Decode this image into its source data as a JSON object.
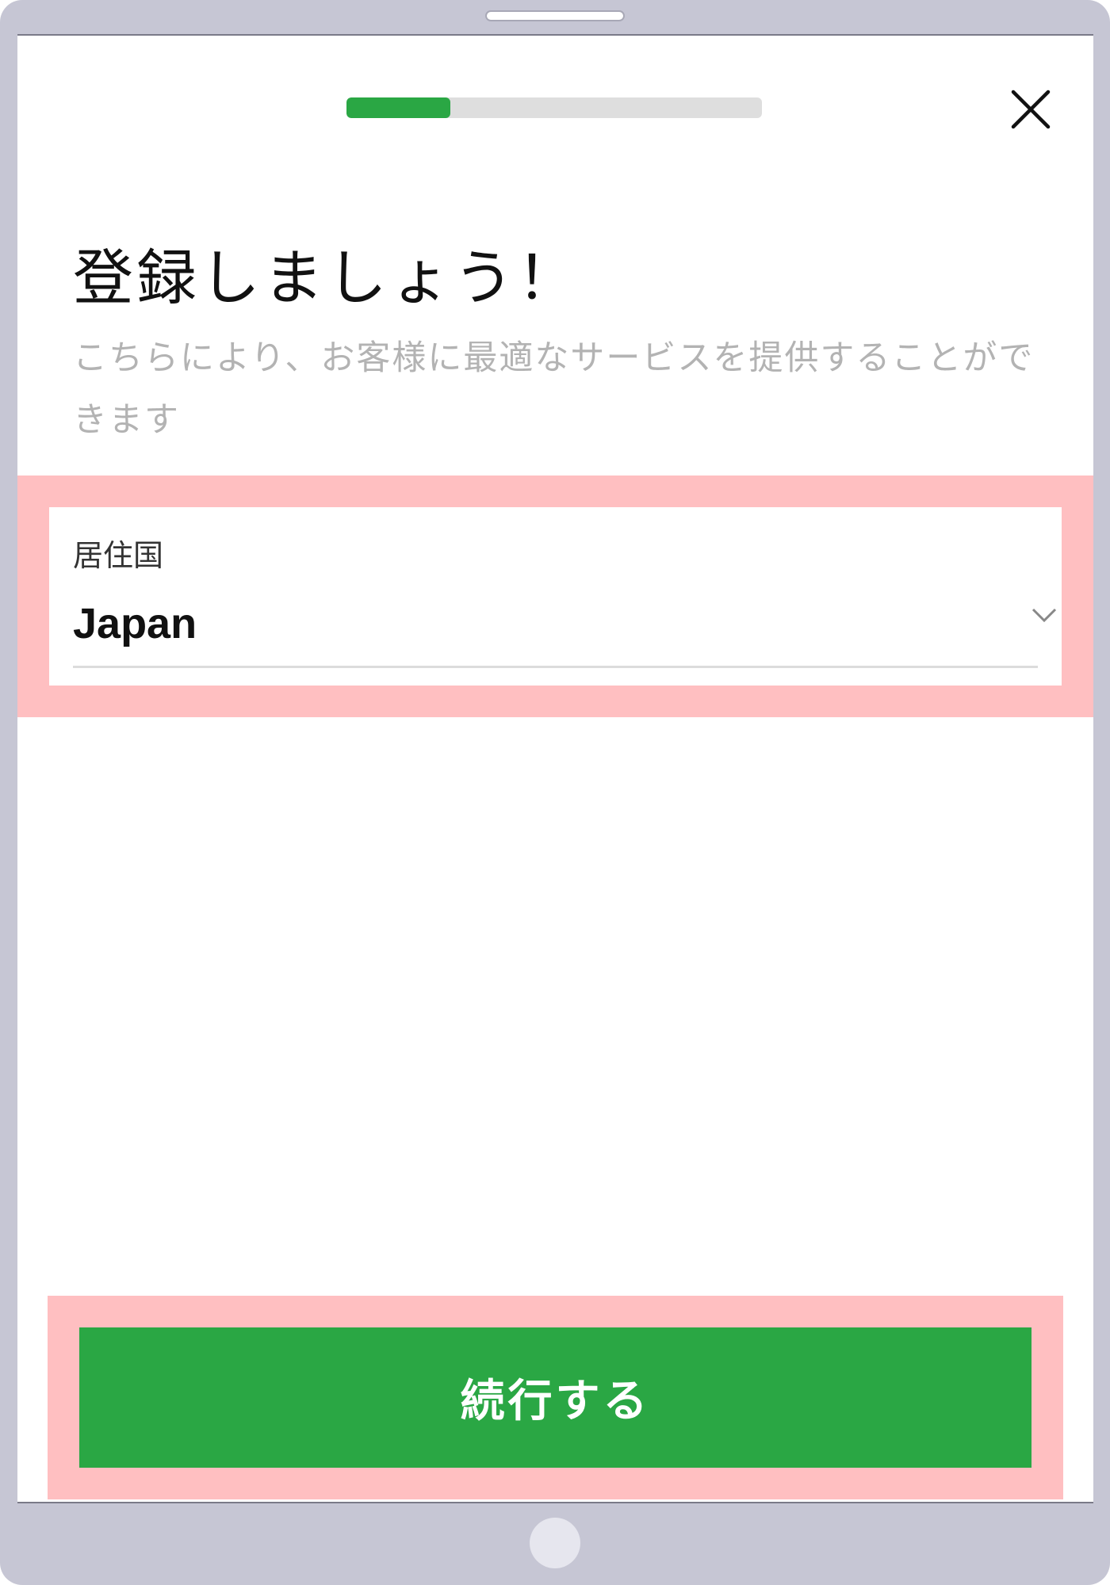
{
  "progress": {
    "fraction": 0.25
  },
  "header": {
    "close_icon": "close-icon"
  },
  "main": {
    "title": "登録しましょう！",
    "subtitle": "こちらにより、お客様に最適なサービスを提供することができます"
  },
  "country_field": {
    "label": "居住国",
    "value": "Japan",
    "icon": "chevron-down-icon"
  },
  "footer": {
    "continue_label": "続行する"
  },
  "colors": {
    "accent": "#2aa744",
    "highlight": "#ffbfc1",
    "progress_track": "#dedede",
    "subtitle_text": "#b3b3b3"
  }
}
